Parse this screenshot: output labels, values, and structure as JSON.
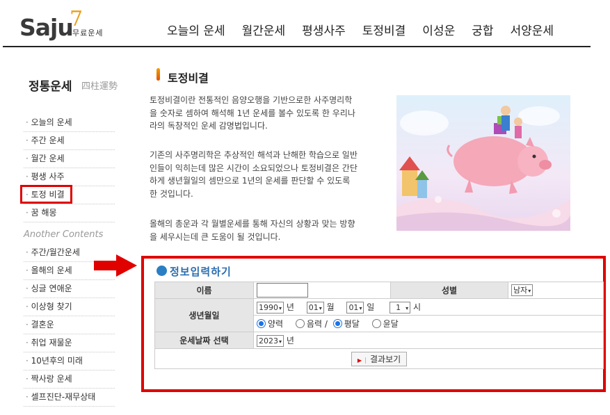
{
  "header": {
    "logo_text": "Saju",
    "logo_number": "7",
    "logo_sub": "무료운세",
    "nav": [
      "오늘의 운세",
      "월간운세",
      "평생사주",
      "토정비결",
      "이성운",
      "궁합",
      "서양운세"
    ]
  },
  "sidebar": {
    "title": "정통운세",
    "title_sub": "四柱運勢",
    "items": [
      "오늘의 운세",
      "주간 운세",
      "월간 운세",
      "평생 사주",
      "토정 비결",
      "꿈 해몽"
    ],
    "another_title": "Another Contents",
    "another_items": [
      "주간/월간운세",
      "올해의 운세",
      "싱글 연애운",
      "이상형 찾기",
      "결혼운",
      "취업 재물운",
      "10년후의 미래",
      "짝사랑 운세",
      "셀프진단-재무상태"
    ],
    "highlighted_item": "토정 비결"
  },
  "main": {
    "section_title": "토정비결",
    "paragraphs": [
      "토정비결이란 전통적인 음양오행을 기반으로한 사주명리학을 숫자로 셈하여 해석해 1년 운세를 볼수 있도록 한 우리나라의 독창적인 운세 감명법입니다.",
      "기존의 사주명리학은 추상적인 해석과 난해한 학습으로 일반인들이 익히는데 많은 시간이 소요되었으나 토정비결은 간단하게 생년월일의 셈만으로 1년의 운세를 판단할 수 있도록 한 것입니다.",
      "올해의 총운과 각 월별운세를 통해 자신의 상황과 맞는 방향을 세우시는데 큰 도움이 될 것입니다."
    ]
  },
  "form": {
    "title": "정보입력하기",
    "name_label": "이름",
    "name_value": "",
    "gender_label": "성별",
    "gender_value": "남자",
    "birth_label": "생년월일",
    "year": "1990",
    "year_unit": "년",
    "month": "01",
    "month_unit": "월",
    "day": "01",
    "day_unit": "일",
    "hour": "1",
    "hour_unit": "시",
    "calendar_options": [
      "양력",
      "음력 /"
    ],
    "leap_options": [
      "평달",
      "윤달"
    ],
    "selected_calendar": "양력",
    "selected_leap": "평달",
    "fortune_year_label": "운세날짜 선택",
    "fortune_year": "2023",
    "fortune_year_unit": "년",
    "submit_label": "결과보기"
  },
  "colors": {
    "highlight_red": "#e00000",
    "form_title_blue": "#2a6db0",
    "radio_blue": "#1a73e8"
  }
}
